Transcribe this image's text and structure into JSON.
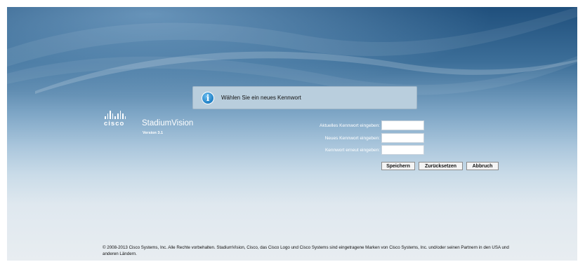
{
  "notice": {
    "icon": "info-icon",
    "message": "Wählen Sie ein neues Kennwort"
  },
  "brand": {
    "logo_text": "cisco",
    "product_name": "StadiumVision",
    "version": "Version 3.1"
  },
  "form": {
    "current_password": {
      "label": "Aktuelles Kennwort eingeben:",
      "value": ""
    },
    "new_password": {
      "label": "Neues Kennwort eingeben:",
      "value": ""
    },
    "confirm_password": {
      "label": "Kennwort erneut eingeben:",
      "value": ""
    }
  },
  "buttons": {
    "save": "Speichern",
    "reset": "Zurücksetzen",
    "cancel": "Abbruch"
  },
  "footer": {
    "copyright": "© 2008-2013 Cisco Systems, Inc. Alle Rechte vorbehalten. StadiumVision, Cisco, das Cisco Logo und Cisco Systems sind eingetragene Marken von Cisco Systems, Inc. und/oder seinen Partnern in den USA und anderen Ländern."
  },
  "colors": {
    "accent_icon": "#1d7ec4",
    "background_top": "#1f4f7c",
    "background_bottom": "#e8edf1"
  }
}
